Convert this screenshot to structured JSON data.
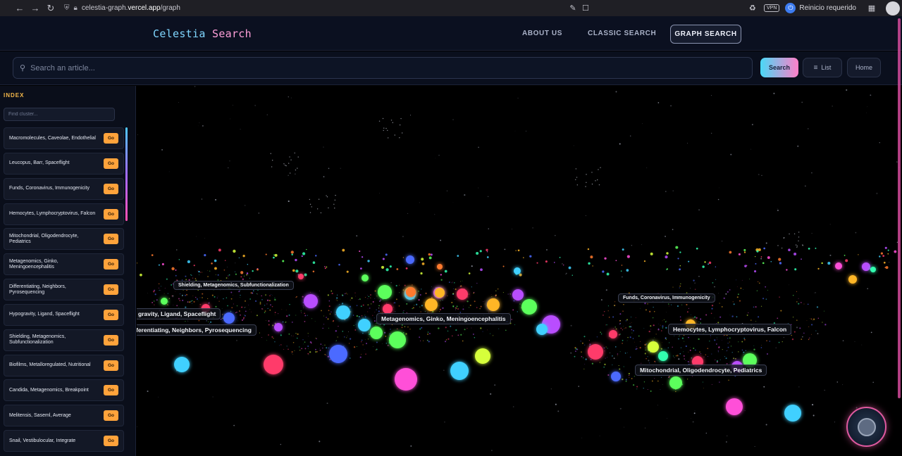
{
  "browser": {
    "url_prefix": "celestia-graph.",
    "url_domain": "vercel.app",
    "url_path": "/graph",
    "vpn": "VPN",
    "restart_text": "Reinicio requerido"
  },
  "header": {
    "logo_part1": "Celestia ",
    "logo_part2": "Search",
    "nav": {
      "about": "ABOUT US",
      "classic": "CLASSIC SEARCH",
      "graph": "GRAPH SEARCH"
    }
  },
  "search": {
    "placeholder": "Search an article...",
    "search_button": "Search",
    "list_button": "List",
    "home_button": "Home"
  },
  "sidebar": {
    "title": "INDEX",
    "filter_placeholder": "Find cluster...",
    "go_label": "Go",
    "clusters": [
      "Macromolecules, Caveolae, Endothelial",
      "Leucopus, Barr, Spaceflight",
      "Funds, Coronavirus, Immunogenicity",
      "Hemocytes, Lymphocryptovirus, Falcon",
      "Mitochondrial, Oligodendrocyte, Pediatrics",
      "Metagenomics, Ginko, Meningoencephalitis",
      "Differentiating, Neighbors, Pyrosequencing",
      "Hypogravity, Ligand, Spaceflight",
      "Shielding, Metagenomics, Subfunctionalization",
      "Biofilms, Metalloregulated, Nutritional",
      "Candida, Metagenomics, Breakpoint",
      "Melitensis, Saseml, Average",
      "Snail, Vestibulocular, Integrate"
    ]
  },
  "graph": {
    "labels": [
      "Shielding, Metagenomics, Subfunctionalization",
      "gravity, Ligand, Spaceflight",
      "ferentiating, Neighbors, Pyrosequencing",
      "Metagenomics, Ginko, Meningoencephalitis",
      "Funds, Coronavirus, Immunogenicity",
      "Hemocytes, Lymphocryptovirus, Falcon",
      "Mitochondrial, Oligodendrocyte, Pediatrics"
    ],
    "colors": [
      "#ff3b6b",
      "#ff4fd8",
      "#3fd0ff",
      "#5cff5c",
      "#ffb627",
      "#b94dff",
      "#4b6bff",
      "#d6ff3a",
      "#30ffb0",
      "#ff7a2d"
    ]
  }
}
